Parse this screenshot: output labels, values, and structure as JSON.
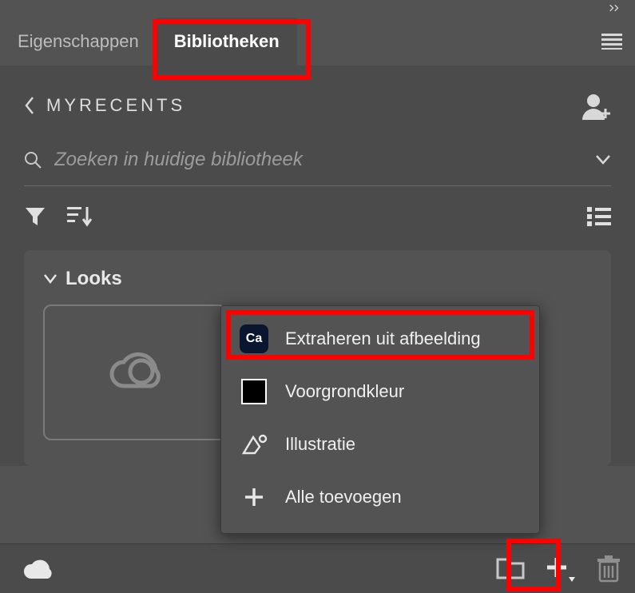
{
  "tabs": {
    "properties": "Eigenschappen",
    "libraries": "Bibliotheken"
  },
  "crumb": {
    "library_name": "MYRECENTS"
  },
  "search": {
    "placeholder": "Zoeken in huidige bibliotheek"
  },
  "section": {
    "looks_title": "Looks"
  },
  "popup": {
    "ca_label": "Ca",
    "extract": "Extraheren uit afbeelding",
    "foreground": "Voorgrondkleur",
    "illustration": "Illustratie",
    "add_all": "Alle toevoegen"
  }
}
